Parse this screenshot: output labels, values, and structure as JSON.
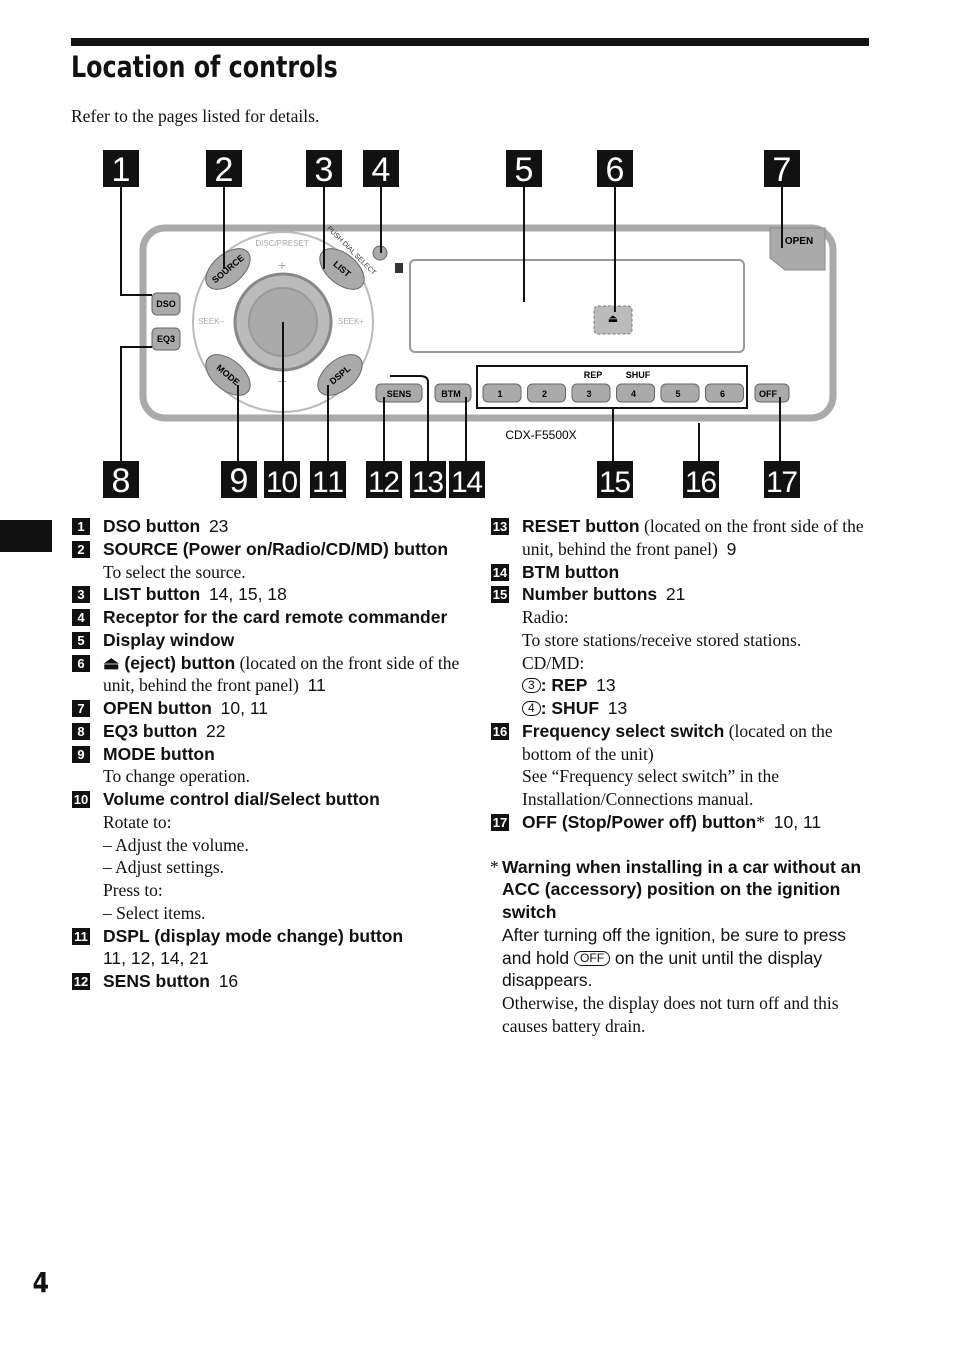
{
  "title": "Location of controls",
  "intro": "Refer to the pages listed for details.",
  "page_number": "4",
  "diagram": {
    "model": "CDX-F5500X",
    "callouts": [
      "1",
      "2",
      "3",
      "4",
      "5",
      "6",
      "7",
      "8",
      "9",
      "10",
      "11",
      "12",
      "13",
      "14",
      "15",
      "16",
      "17"
    ],
    "button_labels": {
      "source": "SOURCE",
      "list": "LIST",
      "mode": "MODE",
      "dspl": "DSPL",
      "dso": "DSO",
      "eq3": "EQ3",
      "disc_preset": "DISC/PRESET",
      "push_dial_select": "PUSH DIAL SELECT",
      "seek_minus": "SEEK–",
      "seek_plus": "SEEK+",
      "plus": "+",
      "minus": "–",
      "sens": "SENS",
      "btm": "BTM",
      "off": "OFF",
      "open": "OPEN",
      "rep": "REP",
      "shuf": "SHUF",
      "numbers": [
        "1",
        "2",
        "3",
        "4",
        "5",
        "6"
      ]
    }
  },
  "left_items": [
    {
      "n": "1",
      "label": "DSO button",
      "pages": "23"
    },
    {
      "n": "2",
      "label": "SOURCE (Power on/Radio/CD/MD) button",
      "lines": [
        "To select the source."
      ]
    },
    {
      "n": "3",
      "label": "LIST button",
      "pages": "14, 15, 18"
    },
    {
      "n": "4",
      "label": "Receptor for the card remote commander"
    },
    {
      "n": "5",
      "label": "Display window"
    },
    {
      "n": "6",
      "label": "⏏ (eject) button",
      "note": "(located on the front side of the unit, behind the front panel)",
      "pages": "11"
    },
    {
      "n": "7",
      "label": "OPEN button",
      "pages": "10, 11"
    },
    {
      "n": "8",
      "label": "EQ3 button",
      "pages": "22"
    },
    {
      "n": "9",
      "label": "MODE button",
      "lines": [
        "To change operation."
      ]
    },
    {
      "n": "10",
      "label": "Volume control dial/Select button",
      "lines": [
        "Rotate to:",
        "– Adjust the volume.",
        "– Adjust settings.",
        "Press to:",
        "– Select items."
      ]
    },
    {
      "n": "11",
      "label": "DSPL (display mode change) button",
      "pages_line": "11, 12, 14, 21"
    },
    {
      "n": "12",
      "label": "SENS button",
      "pages": "16"
    }
  ],
  "right_items": [
    {
      "n": "13",
      "label": "RESET button",
      "note": "(located on the front side of the unit, behind the front panel)",
      "pages": "9"
    },
    {
      "n": "14",
      "label": "BTM button"
    },
    {
      "n": "15",
      "label": "Number buttons",
      "pages": "21",
      "lines": [
        "Radio:",
        "To store stations/receive stored stations.",
        "CD/MD:"
      ],
      "keys": [
        {
          "key": "3",
          "label": ": REP",
          "pages": "13"
        },
        {
          "key": "4",
          "label": ": SHUF",
          "pages": "13"
        }
      ]
    },
    {
      "n": "16",
      "label": "Frequency select switch",
      "note": "(located on the bottom of the unit)",
      "lines": [
        "See “Frequency select switch” in the Installation/Connections manual."
      ]
    },
    {
      "n": "17",
      "label": "OFF (Stop/Power off) button",
      "star": "*",
      "pages": "10, 11"
    }
  ],
  "warning": {
    "star": "*",
    "heading": "Warning when installing in a car without an ACC (accessory) position on the ignition switch",
    "text1": "After turning off the ignition, be sure to press and hold",
    "key": "OFF",
    "text2": "on the unit until the display disappears.",
    "text3": "Otherwise, the display does not turn off and this causes battery drain."
  }
}
